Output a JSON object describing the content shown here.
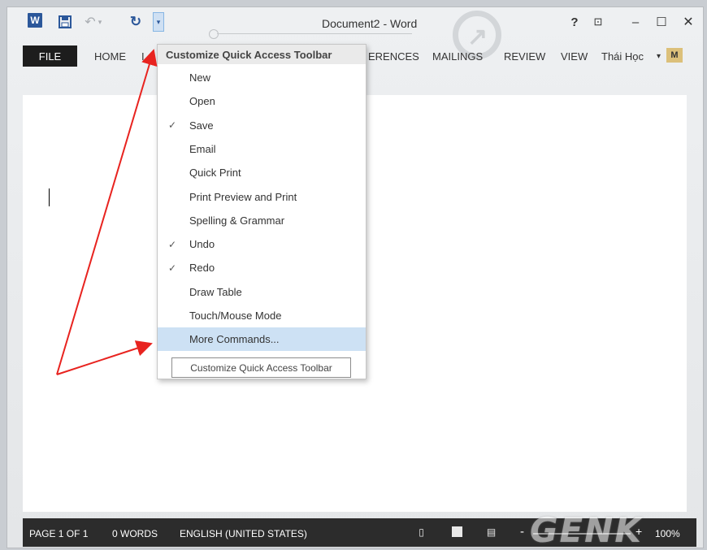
{
  "titlebar": {
    "title": "Document2 - Word",
    "word_icon": "W",
    "help": "?",
    "ribbon_display": "⊡",
    "minimize": "–",
    "maximize": "☐",
    "close": "✕"
  },
  "qat": {
    "save_icon": "save-icon",
    "undo_icon": "undo-icon",
    "redo_icon": "redo-icon",
    "customize_icon": "dropdown-arrow-icon"
  },
  "ribbon": {
    "file": "FILE",
    "home": "HOME",
    "insert_partial": "I",
    "references_partial": "ERENCES",
    "mailings": "MAILINGS",
    "review": "REVIEW",
    "view": "VIEW",
    "user": "Thái Học",
    "user_caret": "▾",
    "avatar_text": "M"
  },
  "menu": {
    "title": "Customize Quick Access Toolbar",
    "items": [
      {
        "label": "New",
        "checked": ""
      },
      {
        "label": "Open",
        "checked": ""
      },
      {
        "label": "Save",
        "checked": "✓"
      },
      {
        "label": "Email",
        "checked": ""
      },
      {
        "label": "Quick Print",
        "checked": ""
      },
      {
        "label": "Print Preview and Print",
        "checked": ""
      },
      {
        "label": "Spelling & Grammar",
        "checked": ""
      },
      {
        "label": "Undo",
        "checked": "✓"
      },
      {
        "label": "Redo",
        "checked": "✓"
      },
      {
        "label": "Draw Table",
        "checked": ""
      },
      {
        "label": "Touch/Mouse Mode",
        "checked": ""
      },
      {
        "label": "More Commands...",
        "checked": ""
      }
    ],
    "tooltip": "Customize Quick Access Toolbar"
  },
  "statusbar": {
    "page": "PAGE 1 OF 1",
    "words": "0 WORDS",
    "language": "ENGLISH (UNITED STATES)",
    "zoom": "100%",
    "zoom_minus": "-",
    "zoom_plus": "+"
  },
  "watermark": "GENK",
  "colors": {
    "accent": "#2b579a",
    "highlight": "#cde1f4",
    "annotation_arrow": "#e8231f",
    "status_bar": "#2c2c2c"
  }
}
